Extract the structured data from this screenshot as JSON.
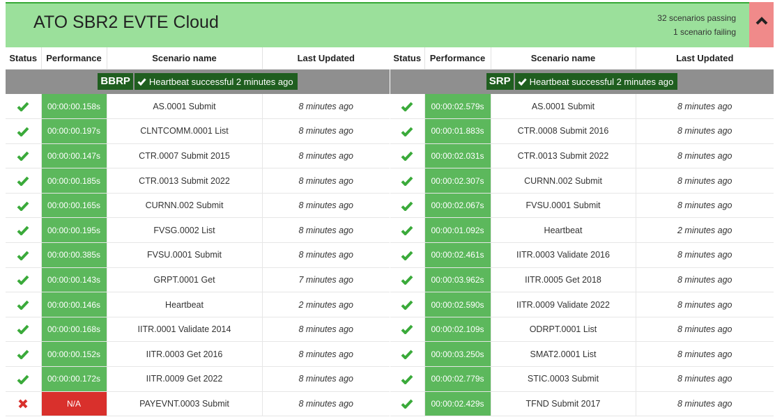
{
  "header": {
    "title": "ATO SBR2 EVTE Cloud",
    "passing": "32 scenarios passing",
    "failing": "1 scenario failing",
    "bg_color": "#9be09b",
    "fail_color": "#f08a8a"
  },
  "columns": {
    "status": "Status",
    "performance": "Performance",
    "scenario": "Scenario name",
    "updated": "Last Updated"
  },
  "panels": [
    {
      "tag": "BBRP",
      "heartbeat": "Heartbeat successful 2 minutes ago",
      "rows": [
        {
          "status": "pass",
          "perf": "00:00:00.158s",
          "name": "AS.0001 Submit",
          "updated": "8 minutes ago"
        },
        {
          "status": "pass",
          "perf": "00:00:00.197s",
          "name": "CLNTCOMM.0001 List",
          "updated": "8 minutes ago"
        },
        {
          "status": "pass",
          "perf": "00:00:00.147s",
          "name": "CTR.0007 Submit 2015",
          "updated": "8 minutes ago"
        },
        {
          "status": "pass",
          "perf": "00:00:00.185s",
          "name": "CTR.0013 Submit 2022",
          "updated": "8 minutes ago"
        },
        {
          "status": "pass",
          "perf": "00:00:00.165s",
          "name": "CURNN.002 Submit",
          "updated": "8 minutes ago"
        },
        {
          "status": "pass",
          "perf": "00:00:00.195s",
          "name": "FVSG.0002 List",
          "updated": "8 minutes ago"
        },
        {
          "status": "pass",
          "perf": "00:00:00.385s",
          "name": "FVSU.0001 Submit",
          "updated": "8 minutes ago"
        },
        {
          "status": "pass",
          "perf": "00:00:00.143s",
          "name": "GRPT.0001 Get",
          "updated": "7 minutes ago"
        },
        {
          "status": "pass",
          "perf": "00:00:00.146s",
          "name": "Heartbeat",
          "updated": "2 minutes ago"
        },
        {
          "status": "pass",
          "perf": "00:00:00.168s",
          "name": "IITR.0001 Validate 2014",
          "updated": "8 minutes ago"
        },
        {
          "status": "pass",
          "perf": "00:00:00.152s",
          "name": "IITR.0003 Get 2016",
          "updated": "8 minutes ago"
        },
        {
          "status": "pass",
          "perf": "00:00:00.172s",
          "name": "IITR.0009 Get 2022",
          "updated": "8 minutes ago"
        },
        {
          "status": "fail",
          "perf": "N/A",
          "name": "PAYEVNT.0003 Submit",
          "updated": "8 minutes ago"
        }
      ]
    },
    {
      "tag": "SRP",
      "heartbeat": "Heartbeat successful 2 minutes ago",
      "rows": [
        {
          "status": "pass",
          "perf": "00:00:02.579s",
          "name": "AS.0001 Submit",
          "updated": "8 minutes ago"
        },
        {
          "status": "pass",
          "perf": "00:00:01.883s",
          "name": "CTR.0008 Submit 2016",
          "updated": "8 minutes ago"
        },
        {
          "status": "pass",
          "perf": "00:00:02.031s",
          "name": "CTR.0013 Submit 2022",
          "updated": "8 minutes ago"
        },
        {
          "status": "pass",
          "perf": "00:00:02.307s",
          "name": "CURNN.002 Submit",
          "updated": "8 minutes ago"
        },
        {
          "status": "pass",
          "perf": "00:00:02.067s",
          "name": "FVSU.0001 Submit",
          "updated": "8 minutes ago"
        },
        {
          "status": "pass",
          "perf": "00:00:01.092s",
          "name": "Heartbeat",
          "updated": "2 minutes ago"
        },
        {
          "status": "pass",
          "perf": "00:00:02.461s",
          "name": "IITR.0003 Validate 2016",
          "updated": "8 minutes ago"
        },
        {
          "status": "pass",
          "perf": "00:00:03.962s",
          "name": "IITR.0005 Get 2018",
          "updated": "8 minutes ago"
        },
        {
          "status": "pass",
          "perf": "00:00:02.590s",
          "name": "IITR.0009 Validate 2022",
          "updated": "8 minutes ago"
        },
        {
          "status": "pass",
          "perf": "00:00:02.109s",
          "name": "ODRPT.0001 List",
          "updated": "8 minutes ago"
        },
        {
          "status": "pass",
          "perf": "00:00:03.250s",
          "name": "SMAT2.0001 List",
          "updated": "8 minutes ago"
        },
        {
          "status": "pass",
          "perf": "00:00:02.779s",
          "name": "STIC.0003 Submit",
          "updated": "8 minutes ago"
        },
        {
          "status": "pass",
          "perf": "00:00:02.429s",
          "name": "TFND Submit 2017",
          "updated": "8 minutes ago"
        }
      ]
    }
  ],
  "colors": {
    "pass_icon": "#3aaa3a",
    "fail_icon": "#d9302c",
    "perf_pass": "#5cb85c",
    "perf_fail": "#d9302c",
    "banner_bg": "#8f8f8f",
    "tag_bg": "#1f5e1f"
  }
}
